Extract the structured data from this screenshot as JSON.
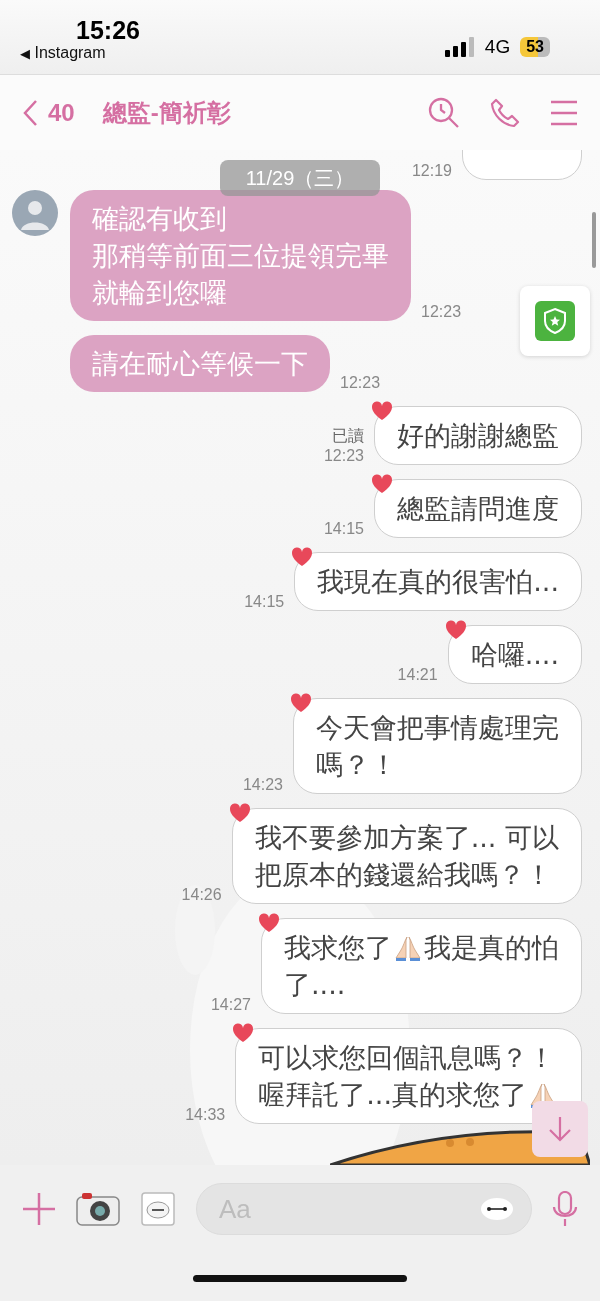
{
  "status_bar": {
    "time": "15:26",
    "back_arrow": "◀",
    "back_app": "Instagram",
    "network": "4G",
    "battery": "53"
  },
  "header": {
    "back_count": "40",
    "title": "總監-簡祈彰"
  },
  "date": "11/29（三）",
  "messages": [
    {
      "kind": "partial",
      "time": "12:19"
    },
    {
      "kind": "incoming",
      "avatar": true,
      "lines": [
        "確認有收到",
        "那稍等前面三位提領完畢",
        "就輪到您囉"
      ],
      "time": "12:23"
    },
    {
      "kind": "incoming",
      "lines": [
        "請在耐心等候一下"
      ],
      "time": "12:23"
    },
    {
      "kind": "outgoing",
      "read": "已讀",
      "lines": [
        "好的謝謝總監"
      ],
      "time": "12:23",
      "liked": true
    },
    {
      "kind": "outgoing",
      "lines": [
        "總監請問進度"
      ],
      "time": "14:15",
      "liked": true
    },
    {
      "kind": "outgoing",
      "lines": [
        "我現在真的很害怕..."
      ],
      "time": "14:15",
      "liked": true
    },
    {
      "kind": "outgoing",
      "lines": [
        "哈囉...."
      ],
      "time": "14:21",
      "liked": true
    },
    {
      "kind": "outgoing",
      "lines": [
        "今天會把事情處理完",
        "嗎？！"
      ],
      "time": "14:23",
      "liked": true
    },
    {
      "kind": "outgoing",
      "lines": [
        "我不要參加方案了... 可以",
        "把原本的錢還給我嗎？！"
      ],
      "time": "14:26",
      "liked": true
    },
    {
      "kind": "outgoing",
      "lines": [
        [
          {
            "kind": "text",
            "text": "我求您了"
          },
          {
            "kind": "emoji"
          },
          {
            "kind": "text",
            "text": "我是真的怕"
          }
        ],
        "了...."
      ],
      "time": "14:27",
      "liked": true
    },
    {
      "kind": "outgoing",
      "lines": [
        "可以求您回個訊息嗎？！",
        [
          {
            "kind": "text",
            "text": "喔拜託了...真的求您了"
          },
          {
            "kind": "emoji"
          }
        ]
      ],
      "time": "14:33",
      "liked": true
    }
  ],
  "input": {
    "placeholder": "Aa"
  }
}
